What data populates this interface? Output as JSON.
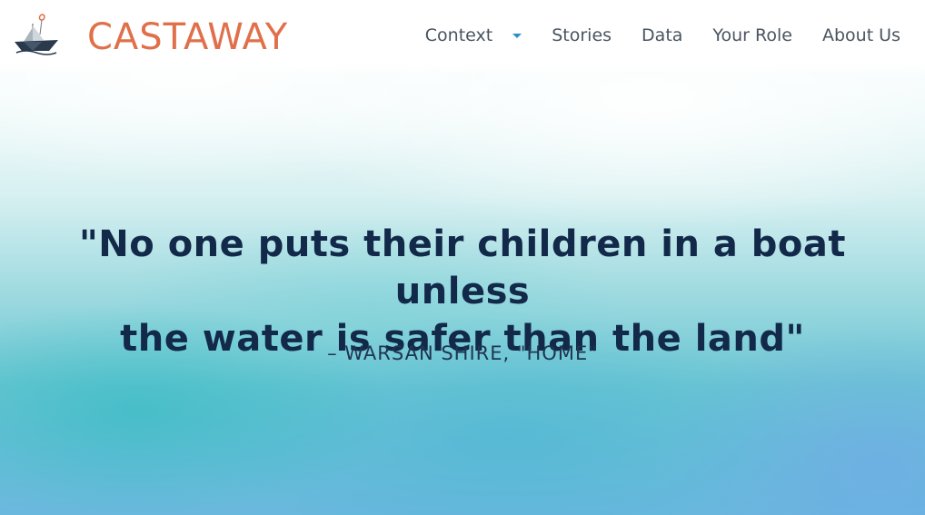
{
  "brand": {
    "name": "CASTAWAY",
    "color": "#e0704a",
    "logo_icon": "paper-boat-icon"
  },
  "nav": {
    "items": [
      {
        "label": "Context",
        "dropdown": true
      },
      {
        "label": "Stories"
      },
      {
        "label": "Data"
      },
      {
        "label": "Your Role"
      },
      {
        "label": "About Us"
      }
    ],
    "dropdown_icon": "caret-down-icon",
    "accent": "#2a8fc4"
  },
  "hero": {
    "quote_line1": "\"No one puts their children in a boat unless",
    "quote_line2": "the water is safer than the land\"",
    "attribution": "– WARSAN SHIRE, \"HOME\"",
    "text_color": "#12294a"
  }
}
